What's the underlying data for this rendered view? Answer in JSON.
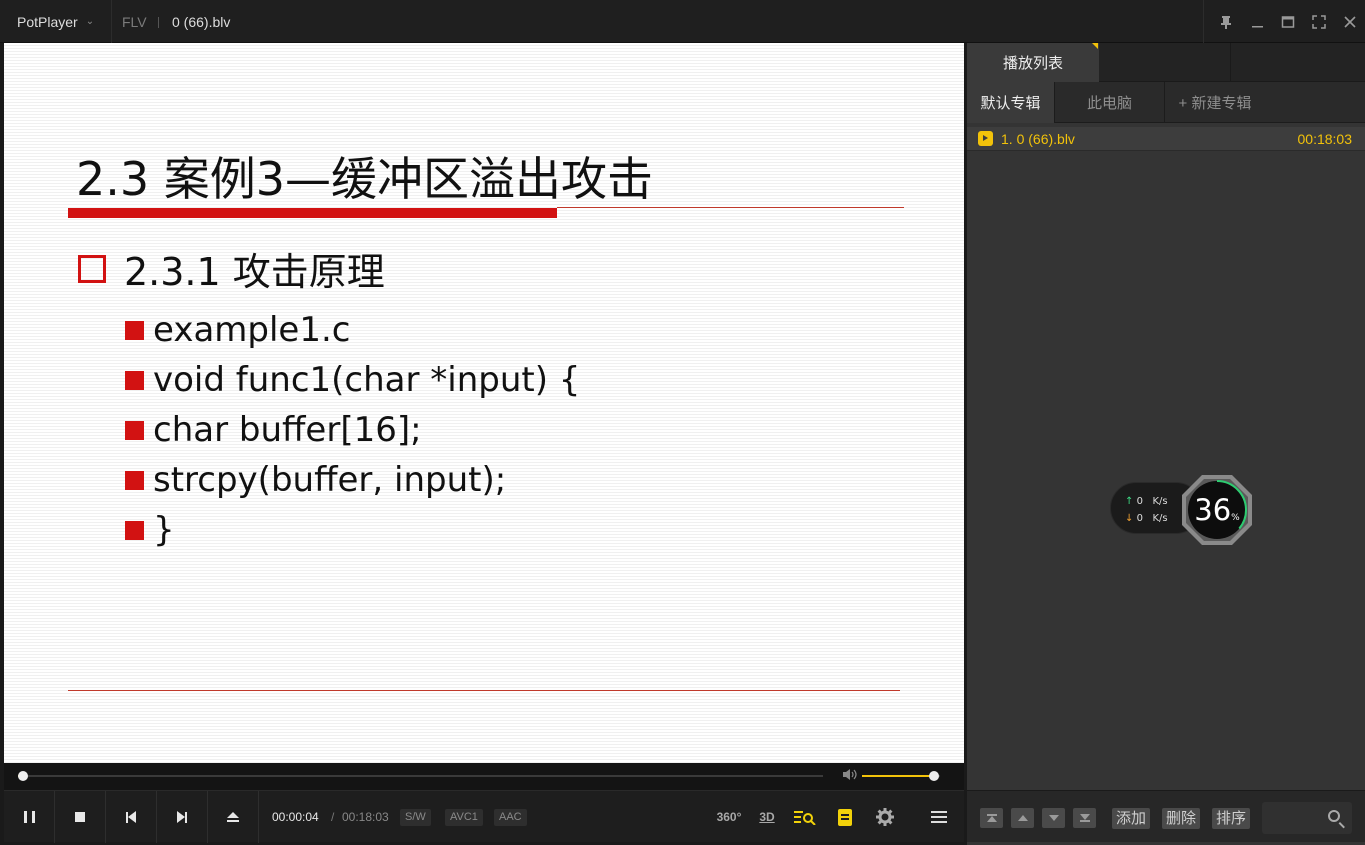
{
  "titlebar": {
    "app_name": "PotPlayer",
    "app_chevron": "⌄",
    "format": "FLV",
    "file_name": "0 (66).blv",
    "controls": [
      "pin-icon",
      "minimize-icon",
      "maximize-icon",
      "fullscreen-icon",
      "close-icon"
    ]
  },
  "slide": {
    "title": "2.3 案例3—缓冲区溢出攻击",
    "heading": "2.3.1 攻击原理",
    "bullets": [
      "example1.c",
      "void func1(char *input) {",
      "char buffer[16];",
      "strcpy(buffer, input);",
      "}"
    ],
    "accent_color": "#d21212"
  },
  "seek": {
    "progress": 0.004,
    "volume": 0.92,
    "accent_color": "#f2c20a"
  },
  "controls": {
    "time_current": "00:00:04",
    "time_separator": "/",
    "time_total": "00:18:03",
    "badges": [
      "S/W",
      "AVC1",
      "AAC"
    ],
    "label_360": "360°",
    "label_3d": "3D"
  },
  "playlist": {
    "tab_label": "播放列表",
    "albums": [
      "默认专辑",
      "此电脑",
      "+ 新建专辑"
    ],
    "items": [
      {
        "name": "1. 0 (66).blv",
        "duration": "00:18:03"
      }
    ],
    "footer_buttons": [
      "添加",
      "删除",
      "排序"
    ],
    "network": {
      "up_value": "0",
      "down_value": "0",
      "unit": "K/s",
      "usage": "36",
      "usage_unit": "%"
    }
  }
}
